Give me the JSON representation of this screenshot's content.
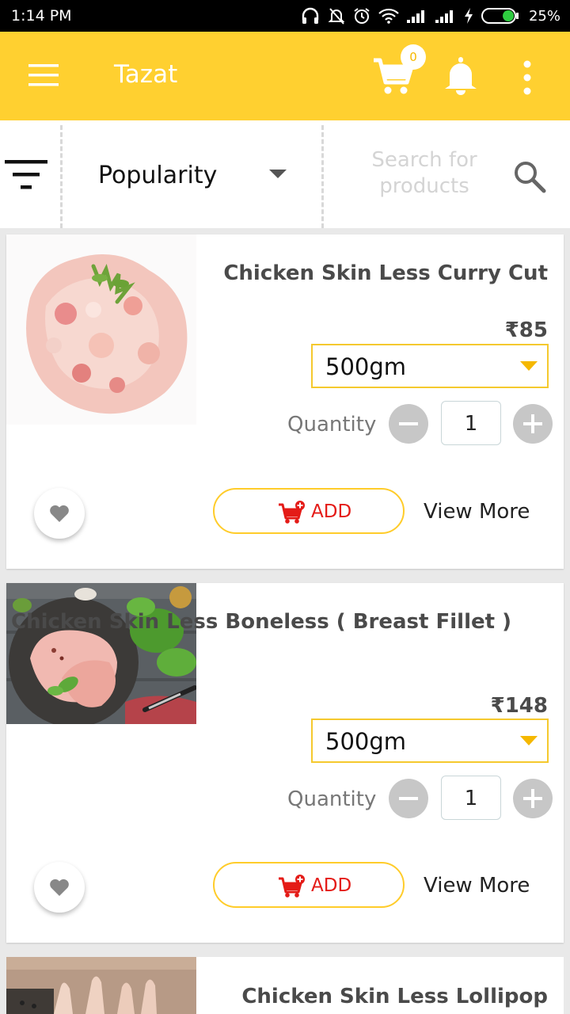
{
  "status_bar": {
    "time": "1:14 PM",
    "battery": "25%"
  },
  "app_bar": {
    "title": "Tazat",
    "cart_count": "0"
  },
  "filter_bar": {
    "sort_selected": "Popularity",
    "search_placeholder": "Search for products"
  },
  "products": [
    {
      "title": "Chicken Skin Less Curry Cut",
      "price": "₹85",
      "weight": "500gm",
      "quantity_label": "Quantity",
      "quantity": "1",
      "add_label": "ADD",
      "view_more_label": "View More"
    },
    {
      "title": "Chicken Skin Less Boneless ( Breast Fillet )",
      "price": "₹148",
      "weight": "500gm",
      "quantity_label": "Quantity",
      "quantity": "1",
      "add_label": "ADD",
      "view_more_label": "View More"
    },
    {
      "title": "Chicken Skin Less Lollipop"
    }
  ],
  "colors": {
    "brand_yellow": "#ffd030",
    "add_red": "#e41b17",
    "dropdown_border": "#f5c92e"
  }
}
